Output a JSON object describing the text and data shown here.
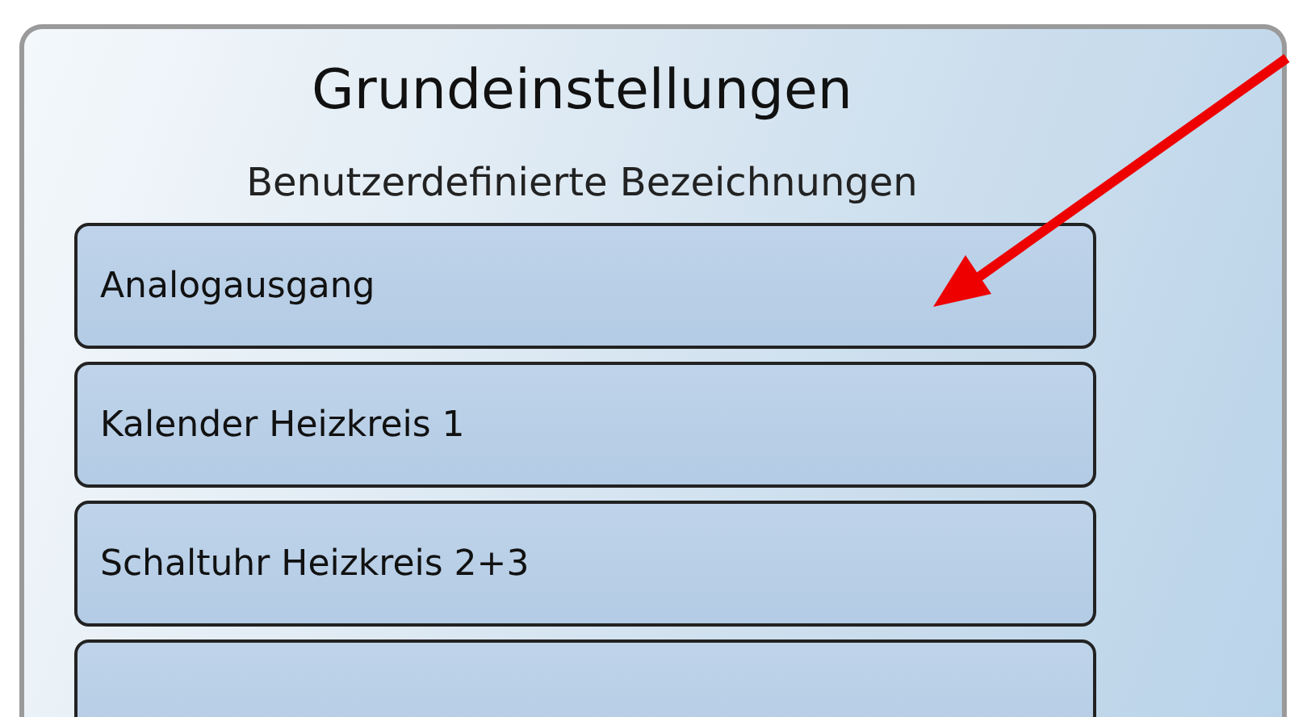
{
  "screen": {
    "title": "Grundeinstellungen",
    "subtitle": "Benutzerdefinierte Bezeichnungen",
    "items": [
      {
        "label": "Analogausgang"
      },
      {
        "label": "Kalender Heizkreis 1"
      },
      {
        "label": "Schaltuhr Heizkreis 2+3"
      }
    ]
  },
  "annotation": {
    "kind": "arrow"
  }
}
